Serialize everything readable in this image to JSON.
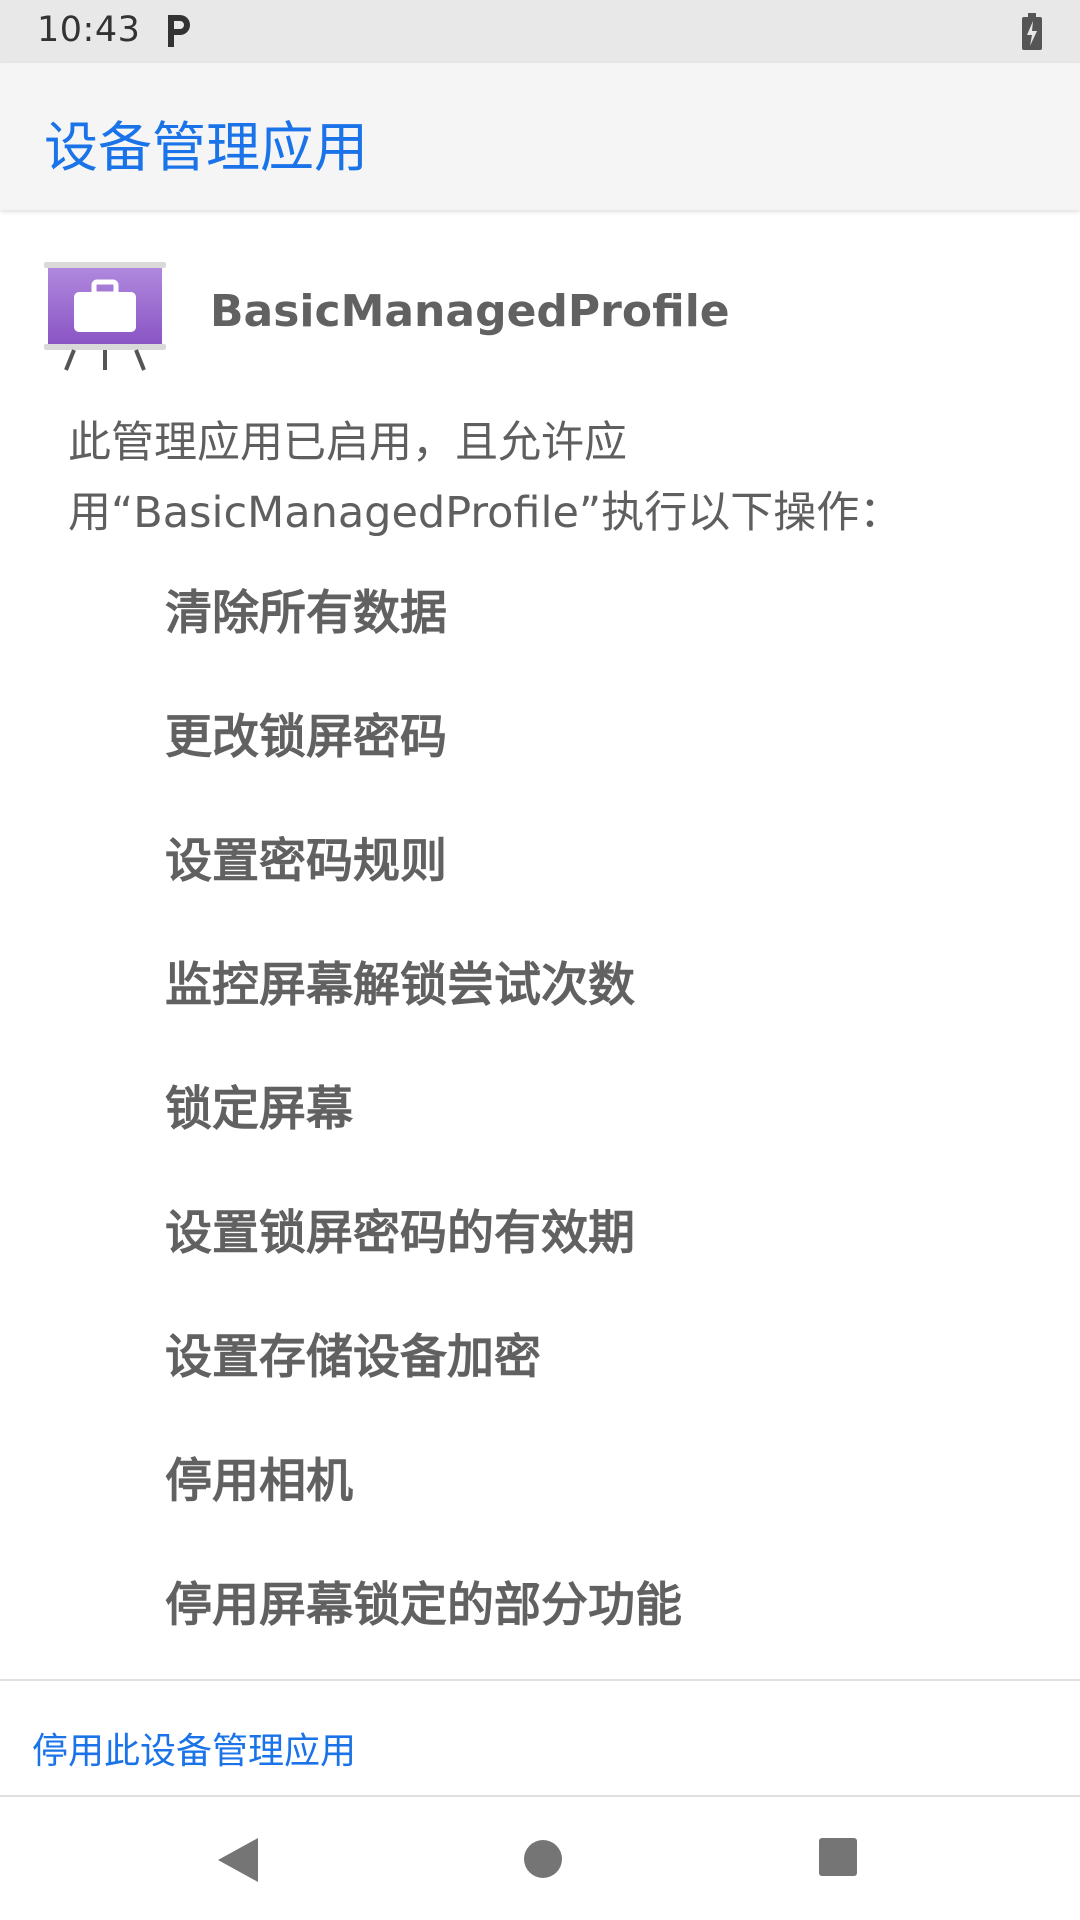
{
  "status_bar": {
    "time": "10:43",
    "notification_icon": "parking-p-icon",
    "battery_icon": "battery-charging-icon"
  },
  "app_bar": {
    "title": "设备管理应用"
  },
  "admin_app": {
    "icon": "briefcase-presentation-icon",
    "name": "BasicManagedProfile",
    "description_line1": "此管理应用已启用，且允许应",
    "description_line2": "用“BasicManagedProfile”执行以下操作："
  },
  "policies": [
    "清除所有数据",
    "更改锁屏密码",
    "设置密码规则",
    "监控屏幕解锁尝试次数",
    "锁定屏幕",
    "设置锁屏密码的有效期",
    "设置存储设备加密",
    "停用相机",
    "停用屏幕锁定的部分功能"
  ],
  "actions": {
    "deactivate_label": "停用此设备管理应用"
  },
  "nav": {
    "back_icon": "back-triangle-icon",
    "home_icon": "home-circle-icon",
    "recents_icon": "recents-square-icon"
  },
  "colors": {
    "accent": "#1a73e8",
    "text_secondary": "#616161",
    "app_icon_purple": "#9c6ad0"
  }
}
